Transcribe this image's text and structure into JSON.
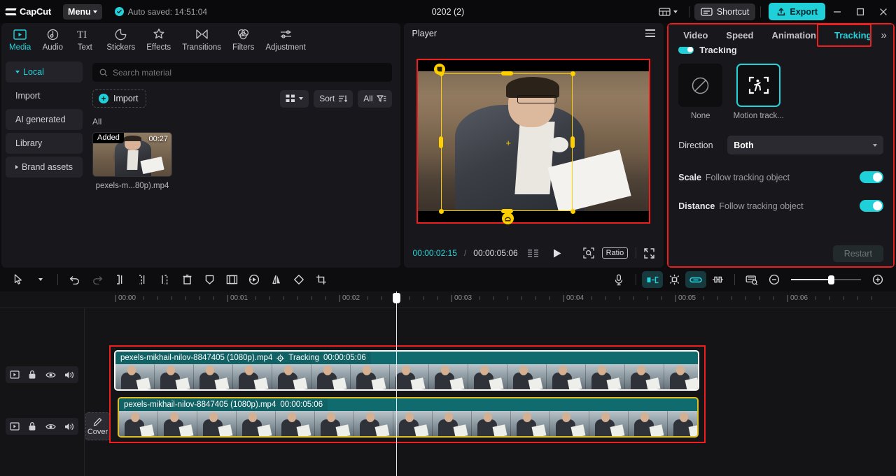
{
  "titlebar": {
    "app_name": "CapCut",
    "menu_label": "Menu",
    "autosave_text": "Auto saved: 14:51:04",
    "document_title": "0202 (2)",
    "shortcut_label": "Shortcut",
    "export_label": "Export",
    "accent_color": "#1fd0d8"
  },
  "tabs": [
    {
      "label": "Media",
      "icon": "media-icon",
      "active": true
    },
    {
      "label": "Audio",
      "icon": "audio-icon",
      "active": false
    },
    {
      "label": "Text",
      "icon": "text-icon",
      "active": false
    },
    {
      "label": "Stickers",
      "icon": "stickers-icon",
      "active": false
    },
    {
      "label": "Effects",
      "icon": "effects-icon",
      "active": false
    },
    {
      "label": "Transitions",
      "icon": "transitions-icon",
      "active": false
    },
    {
      "label": "Filters",
      "icon": "filters-icon",
      "active": false
    },
    {
      "label": "Adjustment",
      "icon": "adjustment-icon",
      "active": false
    }
  ],
  "sidebar": {
    "items": [
      {
        "label": "Local",
        "active": true,
        "expandable": true
      },
      {
        "label": "Import",
        "active": false,
        "expandable": false
      },
      {
        "label": "AI generated",
        "active": false,
        "expandable": false
      },
      {
        "label": "Library",
        "active": false,
        "expandable": false
      },
      {
        "label": "Brand assets",
        "active": false,
        "expandable": true
      }
    ]
  },
  "media_panel": {
    "search_placeholder": "Search material",
    "import_label": "Import",
    "sort_label": "Sort",
    "filter_label": "All",
    "section_label": "All",
    "items": [
      {
        "name": "pexels-m...80p).mp4",
        "duration": "00:27",
        "badge": "Added"
      }
    ]
  },
  "player": {
    "title": "Player",
    "current_time": "00:00:02:15",
    "total_time": "00:00:05:06",
    "ratio_label": "Ratio"
  },
  "right_panel": {
    "tabs": [
      {
        "label": "Video",
        "active": false
      },
      {
        "label": "Speed",
        "active": false
      },
      {
        "label": "Animation",
        "active": false
      },
      {
        "label": "Tracking",
        "active": true
      }
    ],
    "more_label": "»",
    "section_title": "Tracking",
    "options": [
      {
        "label": "None",
        "icon": "none-icon",
        "selected": false
      },
      {
        "label": "Motion track...",
        "icon": "motion-track-icon",
        "selected": true
      }
    ],
    "direction_label": "Direction",
    "direction_value": "Both",
    "scale_label": "Scale",
    "scale_sub": "Follow tracking object",
    "scale_on": true,
    "distance_label": "Distance",
    "distance_sub": "Follow tracking object",
    "distance_on": true,
    "restart_label": "Restart",
    "highlight_color": "#f01f1f"
  },
  "timeline_toolbar": {
    "left_icons": [
      "select-icon",
      "chevron-down-icon",
      "undo-icon",
      "redo-icon",
      "split-left-icon",
      "split-icon",
      "split-right-icon",
      "delete-icon",
      "keyframe-icon",
      "freeze-frame-icon",
      "reverse-icon",
      "mirror-icon",
      "rotate-icon",
      "crop-icon"
    ],
    "right_icons": [
      "microphone-icon",
      "auto-fit-icon",
      "magnet-icon",
      "link-icon",
      "adjust-icon",
      "preview-icon",
      "zoom-out-icon",
      "zoom-in-icon"
    ]
  },
  "timeline": {
    "ruler_labels": [
      "00:00",
      "00:01",
      "00:02",
      "00:03",
      "00:04",
      "00:05",
      "00:06"
    ],
    "cover_label": "Cover",
    "track_head_icons": [
      "track-video-icon",
      "lock-icon",
      "eye-icon",
      "volume-icon"
    ],
    "clips": [
      {
        "name": "pexels-mikhail-nilov-8847405 (1080p).mp4",
        "tracking_label": "Tracking",
        "has_tracking": true,
        "duration": "00:00:05:06",
        "selected": true
      },
      {
        "name": "pexels-mikhail-nilov-8847405 (1080p).mp4",
        "tracking_label": "",
        "has_tracking": false,
        "duration": "00:00:05:06",
        "selected": false
      }
    ]
  }
}
